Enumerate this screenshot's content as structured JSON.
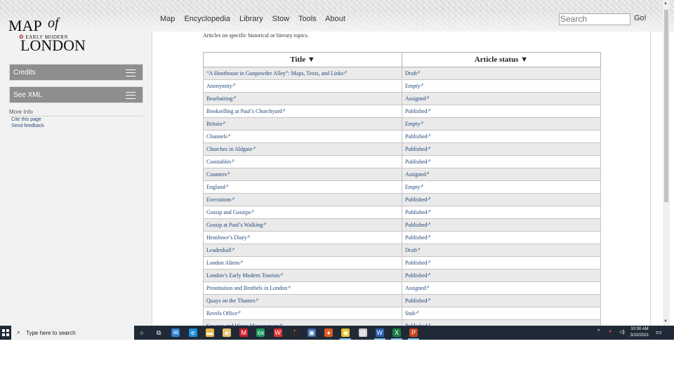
{
  "site": {
    "logo": {
      "map": "MAP",
      "of": "of",
      "early_modern": "EARLY MODERN",
      "london": "LONDON"
    }
  },
  "nav": {
    "items": [
      "Map",
      "Encyclopedia",
      "Library",
      "Stow",
      "Tools",
      "About"
    ],
    "search_placeholder": "Search",
    "go_label": "Go!"
  },
  "sidebar": {
    "credits_label": "Credits",
    "see_xml_label": "See XML",
    "more_info_label": "More Info",
    "links": [
      "Cite this page",
      "Send feedback"
    ]
  },
  "content": {
    "intro": "Articles on specific historical or literary topics.",
    "table": {
      "headers": [
        "Title  ▼",
        "Article status  ▼"
      ],
      "rows": [
        {
          "title": "“A Houthouse in Gunpowder Alley”: Maps, Texts, and Links",
          "status": "Draft"
        },
        {
          "title": "Anonymity",
          "status": "Empty"
        },
        {
          "title": "Bearbaiting",
          "status": "Assigned"
        },
        {
          "title": "Bookselling at Paul’s Churchyard",
          "status": "Published"
        },
        {
          "title": "Britain",
          "status": "Empty"
        },
        {
          "title": "Channels",
          "status": "Published"
        },
        {
          "title": "Churches in Aldgate",
          "status": "Published"
        },
        {
          "title": "Constables",
          "status": "Published"
        },
        {
          "title": "Counters",
          "status": "Assigned"
        },
        {
          "title": "England",
          "status": "Empty"
        },
        {
          "title": "Executions",
          "status": "Published"
        },
        {
          "title": "Gossip and Gossips",
          "status": "Published"
        },
        {
          "title": "Gossip at Paul’s Walking",
          "status": "Published"
        },
        {
          "title": "Henslowe’s Diary",
          "status": "Published"
        },
        {
          "title": "Leadenhall",
          "status": "Draft"
        },
        {
          "title": "London Aliens",
          "status": "Published"
        },
        {
          "title": "London’s Early Modern Tourists",
          "status": "Published"
        },
        {
          "title": "Prostitution and Brothels in London",
          "status": "Assigned"
        },
        {
          "title": "Quays on the Thames",
          "status": "Published"
        },
        {
          "title": "Revels Office",
          "status": "Stub"
        },
        {
          "title": "Sewage and Waste Management",
          "status": "Published"
        }
      ]
    }
  },
  "taskbar": {
    "search_placeholder": "Type here to search",
    "time": "10:30 AM",
    "date": "3/10/2021",
    "apps": [
      "cortana-icon",
      "task-view-icon",
      "mail-icon",
      "edge-icon",
      "file-explorer-icon",
      "store-icon",
      "mcafee-icon",
      "oxygen-icon",
      "word-reader-icon",
      "terminal-icon",
      "photos-icon",
      "drop-icon",
      "chrome-icon",
      "audio-editor-icon",
      "word-icon",
      "excel-icon",
      "powerpoint-icon"
    ]
  },
  "colors": {
    "link": "#21497a",
    "sidebar_button": "#8e8e8e",
    "row_alt": "#eaeaea",
    "taskbar": "#1f2a36"
  }
}
